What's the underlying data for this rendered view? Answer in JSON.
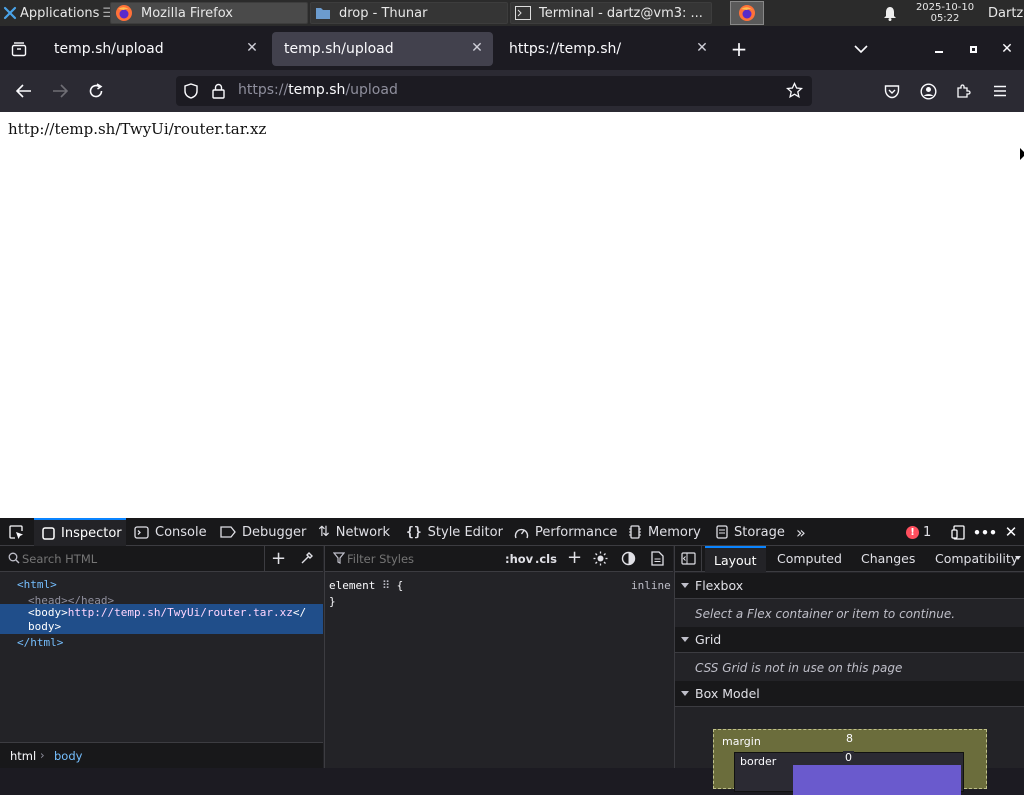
{
  "taskbar": {
    "applications_label": "Applications",
    "tasks": [
      {
        "label": "Mozilla Firefox"
      },
      {
        "label": "drop - Thunar"
      },
      {
        "label": "Terminal - dartz@vm3: ..."
      }
    ],
    "clock_date": "2025-10-10",
    "clock_time": "05:22",
    "user": "Dartz"
  },
  "browser": {
    "tabs": [
      {
        "label": "temp.sh/upload",
        "selected": false
      },
      {
        "label": "temp.sh/upload",
        "selected": true
      },
      {
        "label": "https://temp.sh/",
        "selected": false
      }
    ],
    "url_prefix": "https://",
    "url_host": "temp.sh",
    "url_path": "/upload"
  },
  "page": {
    "text": "http://temp.sh/TwyUi/router.tar.xz"
  },
  "devtools": {
    "tabs": [
      {
        "label": "Inspector"
      },
      {
        "label": "Console"
      },
      {
        "label": "Debugger"
      },
      {
        "label": "Network"
      },
      {
        "label": "Style Editor"
      },
      {
        "label": "Performance"
      },
      {
        "label": "Memory"
      },
      {
        "label": "Storage"
      }
    ],
    "error_count": "1",
    "markup": {
      "search_placeholder": "Search HTML",
      "lines": {
        "html_open": "<html>",
        "head": "<head></head>",
        "body_open": "<body>",
        "body_text": "http://temp.sh/TwyUi/router.tar.xz",
        "body_close_a": "</",
        "body_close_b": "body>",
        "html_close": "</html>"
      },
      "breadcrumbs": [
        "html",
        "body"
      ]
    },
    "rules": {
      "filter_placeholder": "Filter Styles",
      "hov_label": ":hov",
      "cls_label": ".cls",
      "element_selector": "element",
      "open_brace": "{",
      "close_brace": "}",
      "inline_label": "inline"
    },
    "sidebar": {
      "tabs": [
        {
          "label": "Layout"
        },
        {
          "label": "Computed"
        },
        {
          "label": "Changes"
        },
        {
          "label": "Compatibility"
        }
      ],
      "flexbox_title": "Flexbox",
      "flexbox_msg": "Select a Flex container or item to continue.",
      "grid_title": "Grid",
      "grid_msg": "CSS Grid is not in use on this page",
      "boxmodel_title": "Box Model",
      "margin_label": "margin",
      "margin_top": "8",
      "border_label": "border",
      "border_top": "0"
    }
  },
  "colors": {
    "accent": "#0a84ff",
    "selection": "#204e8a",
    "margin_box": "#6b6d3c",
    "padding_box": "#6a5acd"
  }
}
